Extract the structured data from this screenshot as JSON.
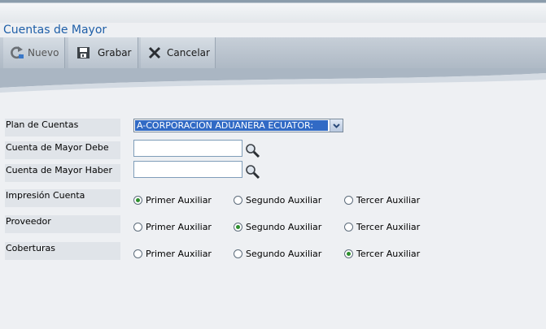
{
  "page": {
    "title": "Cuentas de Mayor"
  },
  "toolbar": {
    "nuevo_label": "Nuevo",
    "grabar_label": "Grabar",
    "cancelar_label": "Cancelar"
  },
  "form": {
    "plan_label": "Plan de Cuentas",
    "plan_value": "A-CORPORACION ADUANERA ECUATOR:",
    "debe_label": "Cuenta de Mayor Debe",
    "debe_value": "",
    "haber_label": "Cuenta de Mayor Haber",
    "haber_value": "",
    "groups": [
      {
        "label": "Impresión Cuenta",
        "options": [
          "Primer Auxiliar",
          "Segundo Auxiliar",
          "Tercer Auxiliar"
        ],
        "selected": "Primer Auxiliar"
      },
      {
        "label": "Proveedor",
        "options": [
          "Primer Auxiliar",
          "Segundo Auxiliar",
          "Tercer Auxiliar"
        ],
        "selected": "Segundo Auxiliar"
      },
      {
        "label": "Coberturas",
        "options": [
          "Primer Auxiliar",
          "Segundo Auxiliar",
          "Tercer Auxiliar"
        ],
        "selected": "Tercer Auxiliar"
      }
    ]
  },
  "colors": {
    "title": "#1f5fa8",
    "selection": "#316ac5",
    "radio_dot": "#2d8f2d"
  },
  "icons": {
    "nuevo": "refresh-icon",
    "grabar": "save-icon",
    "cancelar": "cancel-x-icon",
    "lookup": "magnifier-icon"
  }
}
